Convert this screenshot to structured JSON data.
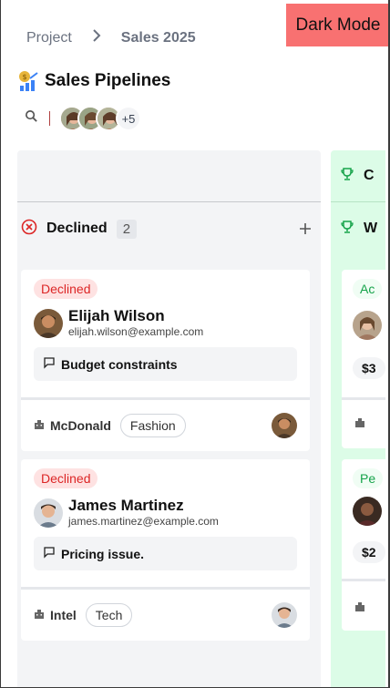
{
  "header": {
    "breadcrumb": [
      "Project",
      "Sales 2025"
    ],
    "dark_mode_label": "Dark Mode",
    "title": "Sales Pipelines",
    "more_members": "+5"
  },
  "columns": {
    "declined": {
      "name": "Declined",
      "count": "2",
      "cards": [
        {
          "status": "Declined",
          "name": "Elijah Wilson",
          "email": "elijah.wilson@example.com",
          "note": "Budget constraints",
          "company": "McDonald",
          "tag": "Fashion"
        },
        {
          "status": "Declined",
          "name": "James Martinez",
          "email": "james.martinez@example.com",
          "note": "Pricing issue.",
          "company": "Intel",
          "tag": "Tech"
        }
      ]
    },
    "won": {
      "top_label_partial": "C",
      "name_partial": "W",
      "cards": [
        {
          "status_partial": "Ac",
          "value_partial": "$3",
          "company_partial": "..."
        },
        {
          "status_partial": "Pe",
          "value_partial": "$2",
          "company_partial": ""
        }
      ]
    }
  },
  "colors": {
    "dark_mode_bg": "#f87171",
    "declined_text": "#dc2626",
    "declined_bg": "#fee2e2",
    "won_bg": "#dcfce7",
    "won_text": "#16a34a"
  }
}
